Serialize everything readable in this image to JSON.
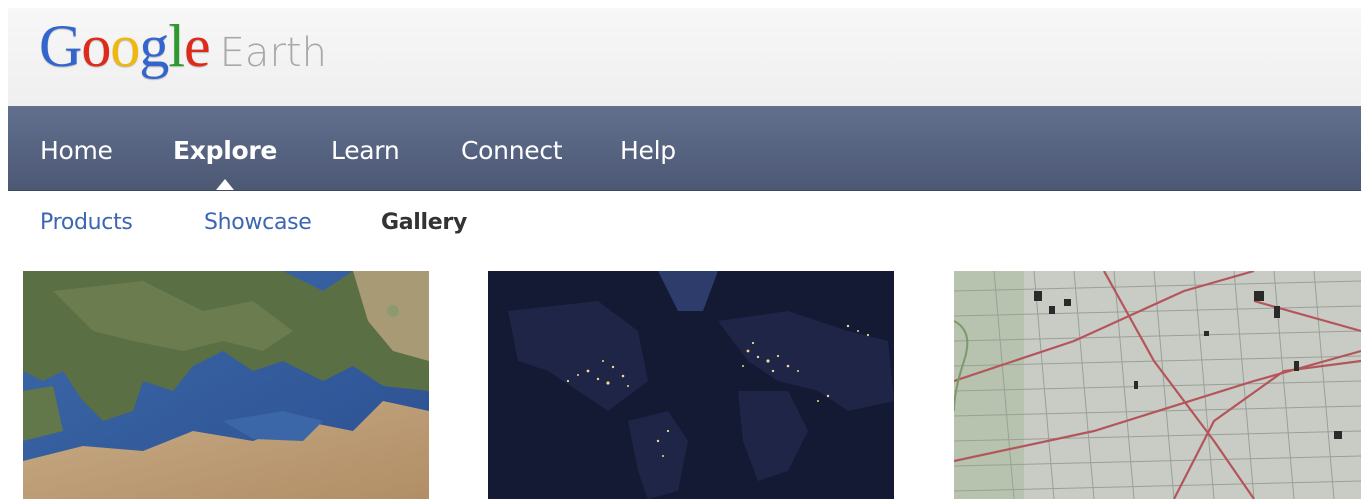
{
  "header": {
    "logo_letters": [
      {
        "ch": "G",
        "color": "#3366cc"
      },
      {
        "ch": "o",
        "color": "#dd2a1a"
      },
      {
        "ch": "o",
        "color": "#f0b70d"
      },
      {
        "ch": "g",
        "color": "#3366cc"
      },
      {
        "ch": "l",
        "color": "#2e9a2e"
      },
      {
        "ch": "e",
        "color": "#dd2a1a"
      }
    ],
    "product": "Earth"
  },
  "nav": {
    "items": [
      {
        "label": "Home",
        "active": false
      },
      {
        "label": "Explore",
        "active": true
      },
      {
        "label": "Learn",
        "active": false
      },
      {
        "label": "Connect",
        "active": false
      },
      {
        "label": "Help",
        "active": false
      }
    ]
  },
  "subnav": {
    "items": [
      {
        "label": "Products",
        "active": false
      },
      {
        "label": "Showcase",
        "active": false
      },
      {
        "label": "Gallery",
        "active": true
      }
    ]
  },
  "gallery": {
    "thumbnails": [
      {
        "subject": "europe-satellite-image"
      },
      {
        "subject": "earth-at-night-image"
      },
      {
        "subject": "topographic-map-image"
      }
    ]
  },
  "colors": {
    "nav_bg": "#55627f",
    "link": "#3c66b3",
    "active_subnav": "#333333"
  }
}
